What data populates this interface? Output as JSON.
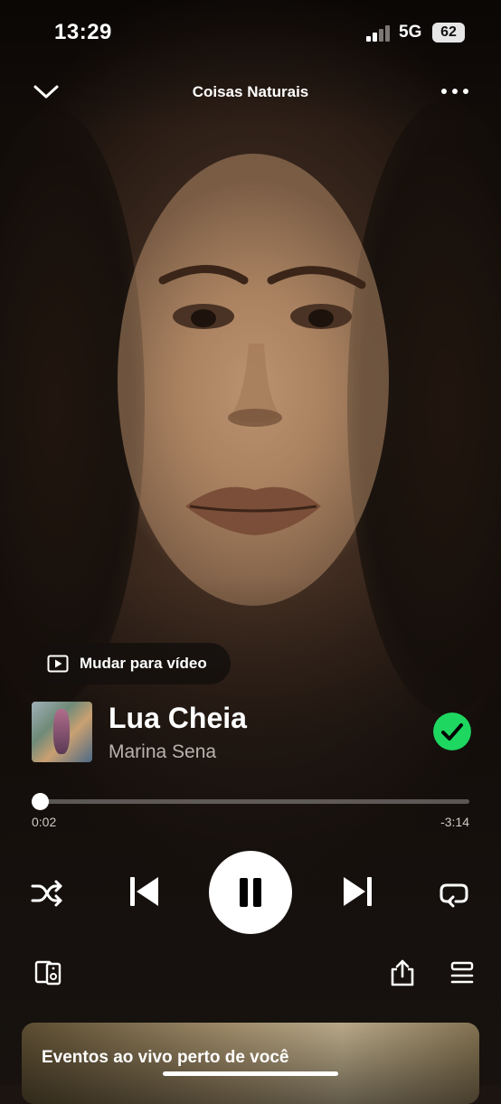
{
  "status_bar": {
    "time": "13:29",
    "network": "5G",
    "battery": "62"
  },
  "header": {
    "title": "Coisas Naturais"
  },
  "video_toggle": {
    "label": "Mudar para vídeo"
  },
  "track": {
    "title": "Lua Cheia",
    "artist": "Marina Sena",
    "liked": true
  },
  "playback": {
    "elapsed": "0:02",
    "remaining": "-3:14",
    "progress_fraction": 0.01,
    "state": "playing"
  },
  "controls": [
    "shuffle-icon",
    "previous-icon",
    "pause-icon",
    "next-icon",
    "repeat-icon"
  ],
  "footer_icons": [
    "connect-device-icon",
    "share-icon",
    "queue-icon"
  ],
  "events_card": {
    "title": "Eventos ao vivo perto de você"
  },
  "colors": {
    "accent_green": "#1ed760",
    "background": "#17120f",
    "secondary_text": "#b9b3ae"
  }
}
